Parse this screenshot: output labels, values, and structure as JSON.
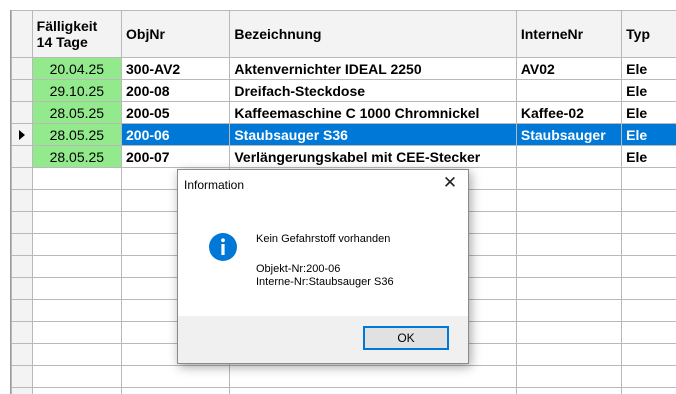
{
  "table": {
    "headers": {
      "faelligkeit_line1": "Fälligkeit",
      "faelligkeit_line2": "14 Tage",
      "objnr": "ObjNr",
      "bezeichnung": "Bezeichnung",
      "internenr": "InterneNr",
      "typ": "Typ"
    },
    "rows": [
      {
        "date": "20.04.25",
        "objnr": "300-AV2",
        "bezeichnung": "Aktenvernichter IDEAL 2250",
        "internenr": "AV02",
        "typ": "Ele"
      },
      {
        "date": "29.10.25",
        "objnr": "200-08",
        "bezeichnung": "Dreifach-Steckdose",
        "internenr": "",
        "typ": "Ele"
      },
      {
        "date": "28.05.25",
        "objnr": "200-05",
        "bezeichnung": "Kaffeemaschine C 1000 Chromnickel",
        "internenr": "Kaffee-02",
        "typ": "Ele"
      },
      {
        "date": "28.05.25",
        "objnr": "200-06",
        "bezeichnung": "Staubsauger S36",
        "internenr": "Staubsauger",
        "typ": "Ele"
      },
      {
        "date": "28.05.25",
        "objnr": "200-07",
        "bezeichnung": "Verlängerungskabel mit CEE-Stecker",
        "internenr": "",
        "typ": "Ele"
      }
    ]
  },
  "dialog": {
    "title": "Information",
    "message": "Kein Gefahrstoff vorhanden",
    "line1": "Objekt-Nr:200-06",
    "line2": "Interne-Nr:Staubsauger S36",
    "ok_label": "OK"
  },
  "colors": {
    "selection": "#0078d7",
    "date_cell": "#93ea8d",
    "info_icon": "#0078d7"
  }
}
